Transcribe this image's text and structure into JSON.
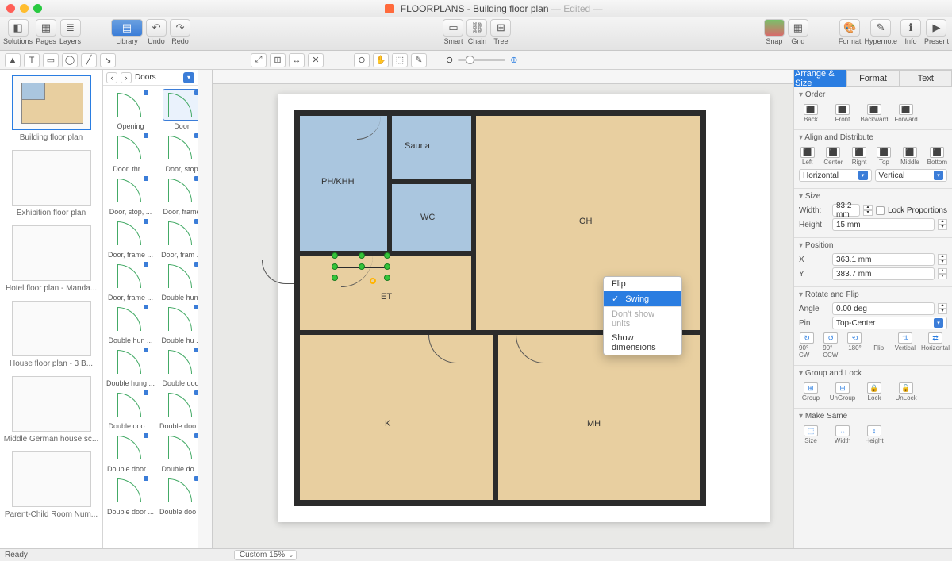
{
  "window": {
    "title": "FLOORPLANS - Building floor plan",
    "edited": "— Edited —"
  },
  "toolbar": {
    "solutions": "Solutions",
    "pages": "Pages",
    "layers": "Layers",
    "library": "Library",
    "undo": "Undo",
    "redo": "Redo",
    "smart": "Smart",
    "chain": "Chain",
    "tree": "Tree",
    "snap": "Snap",
    "grid": "Grid",
    "format": "Format",
    "hypernote": "Hypernote",
    "info": "Info",
    "present": "Present"
  },
  "thumbs": [
    {
      "label": "Building floor plan",
      "active": true
    },
    {
      "label": "Exhibition floor plan"
    },
    {
      "label": "Hotel floor plan - Manda..."
    },
    {
      "label": "House floor plan - 3 B..."
    },
    {
      "label": "Middle German house sc..."
    },
    {
      "label": "Parent-Child Room Num..."
    }
  ],
  "library": {
    "title": "Doors",
    "items": [
      {
        "label": "Opening"
      },
      {
        "label": "Door",
        "selected": true
      },
      {
        "label": "Door, thr ..."
      },
      {
        "label": "Door, stop"
      },
      {
        "label": "Door, stop, ..."
      },
      {
        "label": "Door, frame"
      },
      {
        "label": "Door, frame ..."
      },
      {
        "label": "Door, fram ..."
      },
      {
        "label": "Door, frame ..."
      },
      {
        "label": "Double hung"
      },
      {
        "label": "Double hun ..."
      },
      {
        "label": "Double hu ..."
      },
      {
        "label": "Double hung ..."
      },
      {
        "label": "Double door"
      },
      {
        "label": "Double doo ..."
      },
      {
        "label": "Double doo ..."
      },
      {
        "label": "Double door ..."
      },
      {
        "label": "Double do ..."
      },
      {
        "label": "Double door ..."
      },
      {
        "label": "Double doo ..."
      }
    ]
  },
  "rooms": {
    "sauna": "Sauna",
    "wc": "WC",
    "ph": "PH/KHH",
    "et": "ET",
    "oh": "OH",
    "k": "K",
    "mh": "MH"
  },
  "context_menu": {
    "flip": "Flip",
    "swing": "Swing",
    "dont_show": "Don't show units",
    "show_dim": "Show dimensions"
  },
  "inspector": {
    "tabs": {
      "arrange": "Arrange & Size",
      "format": "Format",
      "text": "Text"
    },
    "order": {
      "hd": "Order",
      "back": "Back",
      "front": "Front",
      "backward": "Backward",
      "forward": "Forward"
    },
    "align": {
      "hd": "Align and Distribute",
      "left": "Left",
      "center": "Center",
      "right": "Right",
      "top": "Top",
      "middle": "Middle",
      "bottom": "Bottom",
      "horizontal": "Horizontal",
      "vertical": "Vertical"
    },
    "size": {
      "hd": "Size",
      "width_l": "Width:",
      "width_v": "83.2 mm",
      "height_l": "Height",
      "height_v": "15 mm",
      "lock": "Lock Proportions"
    },
    "position": {
      "hd": "Position",
      "x_l": "X",
      "x_v": "363.1 mm",
      "y_l": "Y",
      "y_v": "383.7 mm"
    },
    "rotate": {
      "hd": "Rotate and Flip",
      "angle_l": "Angle",
      "angle_v": "0.00 deg",
      "pin_l": "Pin",
      "pin_v": "Top-Center",
      "cw": "90° CW",
      "ccw": "90° CCW",
      "r180": "180°",
      "flip": "Flip",
      "vert": "Vertical",
      "horiz": "Horizontal"
    },
    "group": {
      "hd": "Group and Lock",
      "group": "Group",
      "ungroup": "UnGroup",
      "lock": "Lock",
      "unlock": "UnLock"
    },
    "same": {
      "hd": "Make Same",
      "size": "Size",
      "width": "Width",
      "height": "Height"
    }
  },
  "status": {
    "ready": "Ready",
    "zoom": "Custom 15%"
  }
}
